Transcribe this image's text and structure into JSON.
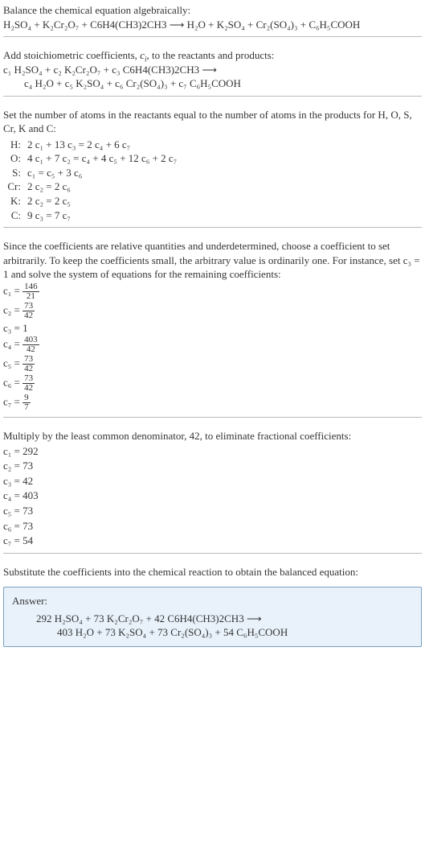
{
  "intro": {
    "line1": "Balance the chemical equation algebraically:",
    "line2": "H₂SO₄ + K₂Cr₂O₇ + C6H4(CH3)2CH3 ⟶ H₂O + K₂SO₄ + Cr₂(SO₄)₃ + C₆H₅COOH"
  },
  "stoich": {
    "line1_a": "Add stoichiometric coefficients, ",
    "line1_ci": "c",
    "line1_i": "i",
    "line1_b": ", to the reactants and products:",
    "line2": "c₁ H₂SO₄ + c₂ K₂Cr₂O₇ + c₃ C6H4(CH3)2CH3 ⟶",
    "line3": "c₄ H₂O + c₅ K₂SO₄ + c₆ Cr₂(SO₄)₃ + c₇ C₆H₅COOH"
  },
  "atoms": {
    "intro": "Set the number of atoms in the reactants equal to the number of atoms in the products for H, O, S, Cr, K and C:",
    "rows": [
      {
        "sym": "H:",
        "eq": "2 c₁ + 13 c₃ = 2 c₄ + 6 c₇"
      },
      {
        "sym": "O:",
        "eq": "4 c₁ + 7 c₂ = c₄ + 4 c₅ + 12 c₆ + 2 c₇"
      },
      {
        "sym": "S:",
        "eq": "c₁ = c₅ + 3 c₆"
      },
      {
        "sym": "Cr:",
        "eq": "2 c₂ = 2 c₆"
      },
      {
        "sym": "K:",
        "eq": "2 c₂ = 2 c₅"
      },
      {
        "sym": "C:",
        "eq": "9 c₃ = 7 c₇"
      }
    ]
  },
  "under": {
    "intro": "Since the coefficients are relative quantities and underdetermined, choose a coefficient to set arbitrarily. To keep the coefficients small, the arbitrary value is ordinarily one. For instance, set c₃ = 1 and solve the system of equations for the remaining coefficients:",
    "coeffs": [
      {
        "lhs": "c₁ =",
        "num": "146",
        "den": "21"
      },
      {
        "lhs": "c₂ =",
        "num": "73",
        "den": "42"
      },
      {
        "lhs": "c₃ =",
        "val": "1"
      },
      {
        "lhs": "c₄ =",
        "num": "403",
        "den": "42"
      },
      {
        "lhs": "c₅ =",
        "num": "73",
        "den": "42"
      },
      {
        "lhs": "c₆ =",
        "num": "73",
        "den": "42"
      },
      {
        "lhs": "c₇ =",
        "num": "9",
        "den": "7"
      }
    ]
  },
  "mult": {
    "intro": "Multiply by the least common denominator, 42, to eliminate fractional coefficients:",
    "coeffs": [
      {
        "lhs": "c₁ =",
        "val": "292"
      },
      {
        "lhs": "c₂ =",
        "val": "73"
      },
      {
        "lhs": "c₃ =",
        "val": "42"
      },
      {
        "lhs": "c₄ =",
        "val": "403"
      },
      {
        "lhs": "c₅ =",
        "val": "73"
      },
      {
        "lhs": "c₆ =",
        "val": "73"
      },
      {
        "lhs": "c₇ =",
        "val": "54"
      }
    ]
  },
  "subst": {
    "intro": "Substitute the coefficients into the chemical reaction to obtain the balanced equation:"
  },
  "answer": {
    "title": "Answer:",
    "line1": "292 H₂SO₄ + 73 K₂Cr₂O₇ + 42 C6H4(CH3)2CH3 ⟶",
    "line2": "403 H₂O + 73 K₂SO₄ + 73 Cr₂(SO₄)₃ + 54 C₆H₅COOH"
  }
}
